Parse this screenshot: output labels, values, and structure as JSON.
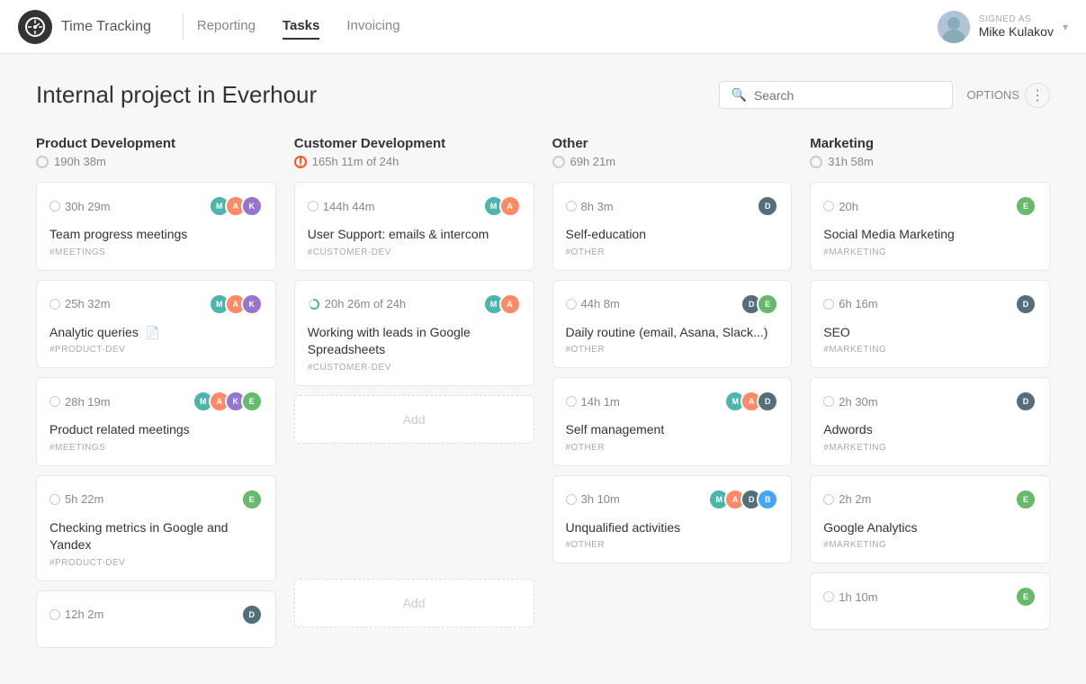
{
  "header": {
    "logo_icon": "⊙",
    "title": "Time Tracking",
    "nav": [
      {
        "id": "reporting",
        "label": "Reporting",
        "active": false
      },
      {
        "id": "tasks",
        "label": "Tasks",
        "active": true
      },
      {
        "id": "invoicing",
        "label": "Invoicing",
        "active": false
      }
    ],
    "signed_as_label": "SIGNED AS",
    "user_name": "Mike Kulakov"
  },
  "page": {
    "title": "Internal project in Everhour",
    "search_placeholder": "Search",
    "options_label": "OPTIONS"
  },
  "columns": [
    {
      "id": "product-dev",
      "title": "Product Development",
      "total_time": "190h 38m",
      "has_budget": false,
      "cards": [
        {
          "id": "pd1",
          "time": "30h 29m",
          "has_budget": false,
          "name": "Team progress meetings",
          "tag": "#MEETINGS",
          "avatars": [
            "teal",
            "orange",
            "purple"
          ]
        },
        {
          "id": "pd2",
          "time": "25h 32m",
          "has_budget": false,
          "name": "Analytic queries",
          "has_doc": true,
          "tag": "#PRODUCT-DEV",
          "avatars": [
            "teal",
            "orange",
            "purple"
          ]
        },
        {
          "id": "pd3",
          "time": "28h 19m",
          "has_budget": false,
          "name": "Product related meetings",
          "tag": "#MEETINGS",
          "avatars": [
            "teal",
            "orange",
            "purple",
            "green"
          ]
        },
        {
          "id": "pd4",
          "time": "5h 22m",
          "has_budget": false,
          "name": "Checking metrics in Google and Yandex",
          "tag": "#PRODUCT-DEV",
          "avatars": [
            "green"
          ]
        },
        {
          "id": "pd5",
          "time": "12h 2m",
          "has_budget": false,
          "name": "",
          "tag": "",
          "avatars": [
            "dark"
          ]
        }
      ]
    },
    {
      "id": "customer-dev",
      "title": "Customer Development",
      "total_time": "165h 11m of 24h",
      "has_budget": true,
      "budget_warning": true,
      "cards": [
        {
          "id": "cd1",
          "time": "144h 44m",
          "has_budget": false,
          "name": "User Support: emails & intercom",
          "tag": "#CUSTOMER-DEV",
          "avatars": [
            "teal",
            "orange"
          ]
        },
        {
          "id": "cd2",
          "time": "20h 26m of 24h",
          "has_budget": true,
          "budget_progress": 85,
          "name": "Working with leads in Google Spreadsheets",
          "tag": "#CUSTOMER-DEV",
          "avatars": [
            "teal",
            "orange"
          ]
        },
        {
          "id": "cd3",
          "add": true
        },
        {
          "id": "cd4",
          "add2": true
        }
      ]
    },
    {
      "id": "other",
      "title": "Other",
      "total_time": "69h 21m",
      "has_budget": false,
      "cards": [
        {
          "id": "ot1",
          "time": "8h 3m",
          "has_budget": false,
          "name": "Self-education",
          "tag": "#OTHER",
          "avatars": [
            "dark"
          ]
        },
        {
          "id": "ot2",
          "time": "44h 8m",
          "has_budget": false,
          "name": "Daily routine (email, Asana, Slack...)",
          "tag": "#OTHER",
          "avatars": [
            "dark",
            "green"
          ]
        },
        {
          "id": "ot3",
          "time": "14h 1m",
          "has_budget": false,
          "name": "Self management",
          "tag": "#OTHER",
          "avatars": [
            "teal",
            "orange",
            "dark"
          ]
        },
        {
          "id": "ot4",
          "time": "3h 10m",
          "has_budget": false,
          "name": "Unqualified activities",
          "tag": "#OTHER",
          "avatars": [
            "teal",
            "orange",
            "dark",
            "blue"
          ]
        }
      ]
    },
    {
      "id": "marketing",
      "title": "Marketing",
      "total_time": "31h 58m",
      "has_budget": false,
      "cards": [
        {
          "id": "mk1",
          "time": "20h",
          "has_budget": false,
          "name": "Social Media Marketing",
          "tag": "#MARKETING",
          "avatars": [
            "green"
          ]
        },
        {
          "id": "mk2",
          "time": "6h 16m",
          "has_budget": false,
          "name": "SEO",
          "tag": "#MARKETING",
          "avatars": [
            "dark"
          ]
        },
        {
          "id": "mk3",
          "time": "2h 30m",
          "has_budget": false,
          "name": "Adwords",
          "tag": "#MARKETING",
          "avatars": [
            "dark"
          ]
        },
        {
          "id": "mk4",
          "time": "2h 2m",
          "has_budget": false,
          "name": "Google Analytics",
          "tag": "#MARKETING",
          "avatars": [
            "green"
          ]
        },
        {
          "id": "mk5",
          "time": "1h 10m",
          "has_budget": false,
          "name": "",
          "tag": "",
          "avatars": [
            "green"
          ]
        }
      ]
    }
  ]
}
